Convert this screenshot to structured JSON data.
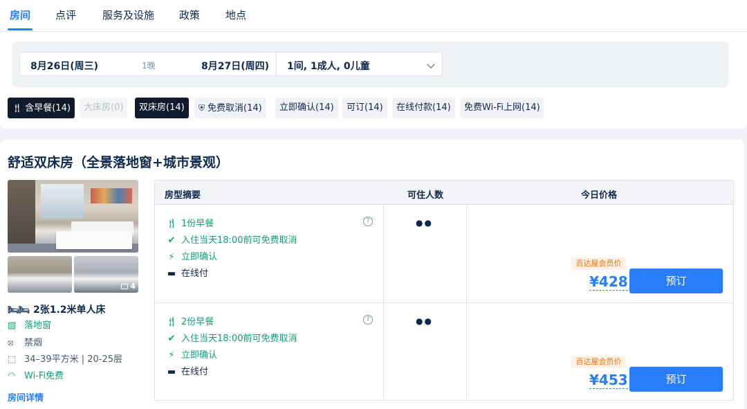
{
  "tabs": [
    {
      "label": "房间",
      "active": true
    },
    {
      "label": "点评"
    },
    {
      "label": "服务及设施"
    },
    {
      "label": "政策"
    },
    {
      "label": "地点"
    }
  ],
  "search": {
    "checkin": "8月26日(周三)",
    "nights": "1晚",
    "checkout": "8月27日(周四)",
    "guests": "1间, 1成人, 0儿童"
  },
  "filters": [
    {
      "label": "含早餐(14)",
      "state": "selected",
      "icon": "utensils-icon"
    },
    {
      "label": "大床房(0)",
      "state": "disabled"
    },
    {
      "label": "双床房(14)",
      "state": "selected"
    },
    {
      "label": "免费取消(14)",
      "icon": "shield-icon"
    },
    {
      "label": "立即确认(14)"
    },
    {
      "label": "可订(14)"
    },
    {
      "label": "在线付款(14)"
    },
    {
      "label": "免费Wi-Fi上网(14)"
    }
  ],
  "room": {
    "title": "舒适双床房（全景落地窗+城市景观）",
    "photo_count": "4",
    "bed": "2张1.2米单人床",
    "amenities": [
      {
        "label": "落地窗",
        "icon": "window-icon",
        "tone": "green"
      },
      {
        "label": "禁烟",
        "icon": "no-smoking-icon",
        "tone": "gray"
      },
      {
        "label": "34–39平方米 | 20-25层",
        "icon": "area-icon",
        "tone": "gray"
      },
      {
        "label": "Wi-Fi免费",
        "icon": "wifi-icon",
        "tone": "green"
      }
    ],
    "detail_link": "房间详情"
  },
  "table": {
    "headers": {
      "summary": "房型摘要",
      "occupancy": "可住人数",
      "price": "今日价格"
    },
    "rows": [
      {
        "breakfast": "1份早餐",
        "cancel": "入住当天18:00前可免费取消",
        "confirm": "立即确认",
        "payment": "在线付",
        "occupancy": "2",
        "member_tag": "百达屋会员价",
        "price": "¥428",
        "book": "预订"
      },
      {
        "breakfast": "2份早餐",
        "cancel": "入住当天18:00前可免费取消",
        "confirm": "立即确认",
        "payment": "在线付",
        "occupancy": "2",
        "member_tag": "百达屋会员价",
        "price": "¥453",
        "book": "预订"
      }
    ]
  },
  "colors": {
    "accent": "#287dfa",
    "green": "#0f9e7a",
    "member": "#ff6f00",
    "chip_selected": "#0f1a2b"
  }
}
